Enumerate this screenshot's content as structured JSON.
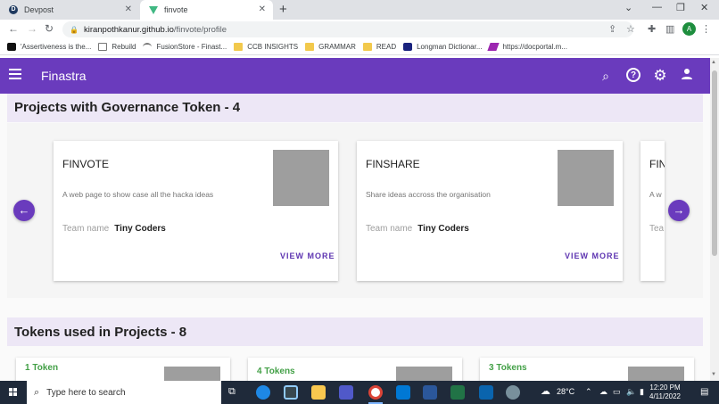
{
  "browser": {
    "tabs": [
      {
        "title": "Devpost",
        "favicon": "devpost-icon",
        "active": false
      },
      {
        "title": "finvote",
        "favicon": "vue-icon",
        "active": true
      }
    ],
    "new_tab_symbol": "+",
    "close_symbol": "✕",
    "address": {
      "host": "kiranpothkanur.github.io",
      "path": "/finvote/profile"
    },
    "profile_initial": "A",
    "bookmarks": [
      {
        "label": "'Assertiveness is the...",
        "icon": "notion-icon"
      },
      {
        "label": "Rebuild",
        "icon": "bookmark-icon"
      },
      {
        "label": "FusionStore - Finast...",
        "icon": "fusion-icon"
      },
      {
        "label": "CCB INSIGHTS",
        "icon": "folder-icon"
      },
      {
        "label": "GRAMMAR",
        "icon": "folder-icon"
      },
      {
        "label": "READ",
        "icon": "folder-icon"
      },
      {
        "label": "Longman Dictionar...",
        "icon": "longman-icon"
      },
      {
        "label": "https://docportal.m...",
        "icon": "link-icon"
      }
    ]
  },
  "app": {
    "brand": "Finastra",
    "header_icons": [
      "search-icon",
      "help-icon",
      "settings-icon",
      "account-icon"
    ],
    "colors": {
      "primary": "#6a3bbd",
      "section_bg": "#ede7f6",
      "token_green": "#43a047"
    }
  },
  "projects_section": {
    "heading": "Projects with Governance Token - 4",
    "team_label": "Team name",
    "view_more_label": "VIEW MORE",
    "cards": [
      {
        "title": "FINVOTE",
        "description": "A web page to show case all the hacka ideas",
        "team": "Tiny Coders"
      },
      {
        "title": "FINSHARE",
        "description": "Share ideas accross the organisation",
        "team": "Tiny Coders"
      },
      {
        "title": "FIN",
        "description": "A w",
        "team_label_partial": "Tea"
      }
    ]
  },
  "tokens_section": {
    "heading": "Tokens used in Projects - 8",
    "cards": [
      {
        "count_label": "1 Token"
      },
      {
        "count_label": "4 Tokens"
      },
      {
        "count_label": "3 Tokens"
      }
    ]
  },
  "taskbar": {
    "search_placeholder": "Type here to search",
    "weather": "28°C",
    "time": "12:20 PM",
    "date": "4/11/2022"
  }
}
